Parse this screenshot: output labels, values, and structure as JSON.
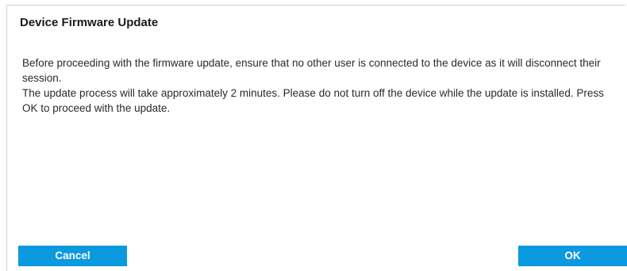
{
  "dialog": {
    "title": "Device Firmware Update",
    "paragraph_1": "Before proceeding with the firmware update, ensure that no other user is connected to the device as it will disconnect their session.",
    "paragraph_2": "The update process will take approximately 2 minutes. Please do not turn off the device while the update is installed. Press OK to proceed with the update.",
    "cancel_label": "Cancel",
    "ok_label": "OK"
  },
  "colors": {
    "button_background": "#0b99e0",
    "button_text": "#ffffff",
    "title_text": "#1a1a1a",
    "body_text": "#2a2a2a"
  }
}
